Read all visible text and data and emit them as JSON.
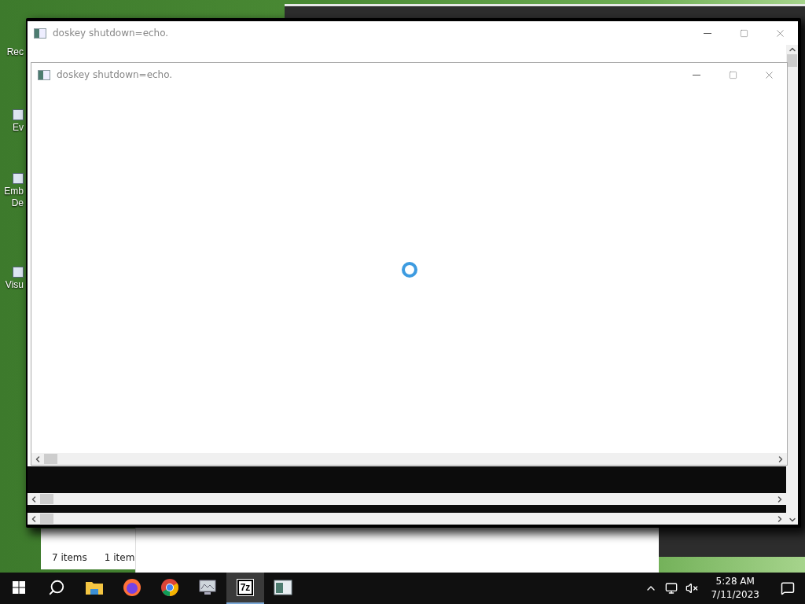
{
  "desktop": {
    "icons": [
      {
        "lines": [
          "Rec"
        ]
      },
      {
        "lines": [
          "Ev"
        ]
      },
      {
        "lines": [
          "Emb",
          "De"
        ]
      },
      {
        "lines": [
          "Visu"
        ]
      }
    ]
  },
  "explorer": {
    "status": [
      "7 items",
      "1 item"
    ]
  },
  "console_back": {
    "title": "doskey  shutdown=echo."
  },
  "console_front": {
    "title": "doskey  shutdown=echo.",
    "loading": true
  },
  "taskbar": {
    "apps": [
      {
        "kind": "explorer",
        "selected": false
      },
      {
        "kind": "firefox",
        "selected": false
      },
      {
        "kind": "chrome",
        "selected": false
      },
      {
        "kind": "monitor",
        "selected": false
      },
      {
        "kind": "sevenzip",
        "selected": true,
        "glyph": "7z"
      },
      {
        "kind": "console",
        "selected": false
      }
    ],
    "clock": {
      "time": "5:28 AM",
      "date": "7/11/2023"
    }
  }
}
